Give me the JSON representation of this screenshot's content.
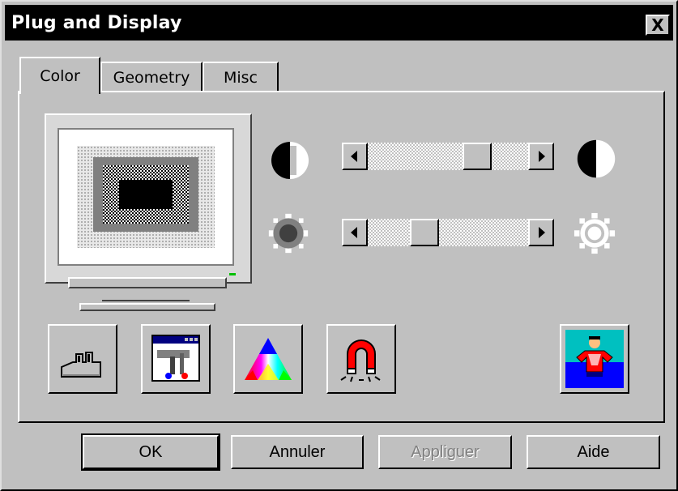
{
  "window": {
    "title": "Plug and Display",
    "close_label": "X"
  },
  "tabs": [
    {
      "label": "Color",
      "active": true
    },
    {
      "label": "Geometry",
      "active": false
    },
    {
      "label": "Misc",
      "active": false
    }
  ],
  "sliders": {
    "contrast": {
      "value": 0.72,
      "left_icon": "contrast-low-icon",
      "right_icon": "contrast-high-icon"
    },
    "brightness": {
      "value": 0.32,
      "left_icon": "brightness-low-icon",
      "right_icon": "brightness-high-icon"
    }
  },
  "tools": [
    {
      "icon": "factory-icon"
    },
    {
      "icon": "window-tools-icon"
    },
    {
      "icon": "color-triangle-icon"
    },
    {
      "icon": "magnet-icon"
    },
    {
      "icon": "superhero-icon"
    }
  ],
  "buttons": {
    "ok": "OK",
    "cancel": "Annuler",
    "apply": "Appliguer",
    "help": "Aide"
  },
  "colors": {
    "titlebar": "#000000",
    "face": "#c0c0c0",
    "led": "#00c000"
  }
}
